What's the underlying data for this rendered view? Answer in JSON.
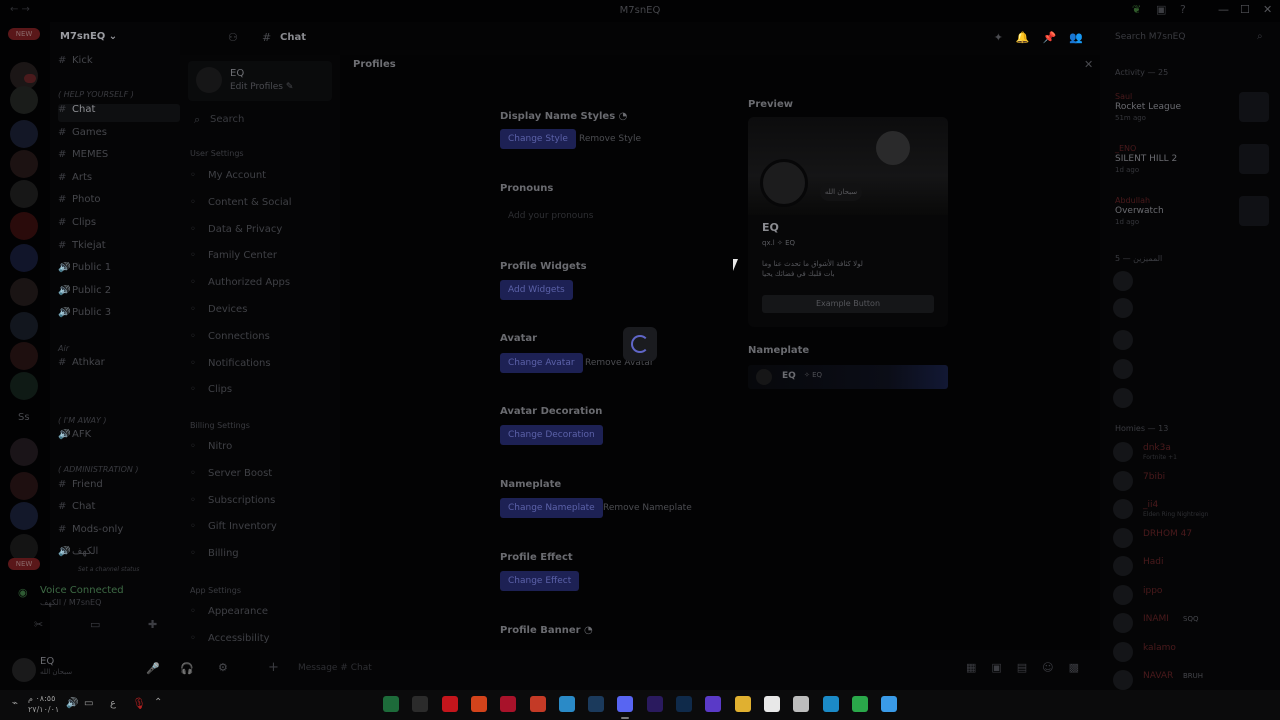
{
  "window": {
    "title": "M7snEQ",
    "back": "←  →"
  },
  "server": {
    "name": "M7snEQ"
  },
  "rail": {
    "new_label": "NEW",
    "ss_label": "Ss"
  },
  "channels": {
    "items": [
      {
        "label": "Kick",
        "icon": "#",
        "active": false
      },
      {
        "label": "Chat",
        "icon": "#",
        "active": true
      },
      {
        "label": "Games",
        "icon": "#",
        "active": false
      },
      {
        "label": "MEMES",
        "icon": "#",
        "active": false
      },
      {
        "label": "Arts",
        "icon": "#",
        "active": false
      },
      {
        "label": "Photo",
        "icon": "#",
        "active": false
      },
      {
        "label": "Clips",
        "icon": "#",
        "active": false
      },
      {
        "label": "Tkiejat",
        "icon": "#",
        "active": false
      },
      {
        "label": "Public 1",
        "icon": "🔊",
        "active": false
      },
      {
        "label": "Public 2",
        "icon": "🔊",
        "active": false
      },
      {
        "label": "Public 3",
        "icon": "🔊",
        "active": false
      },
      {
        "label": "Athkar",
        "icon": "#",
        "active": false
      },
      {
        "label": "AFK",
        "icon": "🔊",
        "active": false
      },
      {
        "label": "Friend",
        "icon": "#",
        "active": false
      },
      {
        "label": "Chat",
        "icon": "#",
        "active": false
      },
      {
        "label": "Mods-only",
        "icon": "#",
        "active": false
      },
      {
        "label": "الكهف",
        "icon": "🔊",
        "active": false
      }
    ],
    "cat_help": "( HELP YOURSELF )",
    "cat_air": "Air",
    "cat_away": "( I'M AWAY )",
    "cat_admin": "( ADMINISTRATION )",
    "channel_status": "Set a channel status"
  },
  "voice": {
    "title": "Voice Connected",
    "sub": "الكهف / M7snEQ"
  },
  "user": {
    "name": "EQ",
    "status": "سبحان الله"
  },
  "settings_nav": {
    "profile_name": "EQ",
    "profile_edit": "Edit Profiles ✎",
    "search_placeholder": "Search",
    "user_settings_head": "User Settings",
    "user_items": [
      "My Account",
      "Content & Social",
      "Data & Privacy",
      "Family Center",
      "Authorized Apps",
      "Devices",
      "Connections",
      "Notifications",
      "Clips"
    ],
    "billing_head": "Billing Settings",
    "billing_items": [
      "Nitro",
      "Server Boost",
      "Subscriptions",
      "Gift Inventory",
      "Billing"
    ],
    "app_head": "App Settings",
    "app_items": [
      "Appearance",
      "Accessibility"
    ]
  },
  "main": {
    "page_title": "Profiles",
    "display_name_styles": "Display Name Styles",
    "change_style": "Change Style",
    "remove_style": "Remove Style",
    "pronouns": "Pronouns",
    "pronouns_placeholder": "Add your pronouns",
    "profile_widgets": "Profile Widgets",
    "add_widgets": "Add Widgets",
    "avatar": "Avatar",
    "change_avatar": "Change Avatar",
    "remove_avatar": "Remove Avatar",
    "avatar_decoration": "Avatar Decoration",
    "change_decoration": "Change Decoration",
    "nameplate": "Nameplate",
    "change_nameplate": "Change Nameplate",
    "remove_nameplate": "Remove Nameplate",
    "profile_effect": "Profile Effect",
    "change_effect": "Change Effect",
    "profile_banner": "Profile Banner"
  },
  "preview": {
    "label": "Preview",
    "bubble": "سبحان الله",
    "name": "EQ",
    "meta": "qx.l  ✧ EQ",
    "bio": "لولا كثافة الأشواق ما تحدث عنا وما بات قلبك في فضائك يحيا",
    "button": "Example Button",
    "nameplate_label": "Nameplate",
    "nameplate_name": "EQ",
    "nameplate_tag": "✧ EQ"
  },
  "topbar": {
    "channel": "Chat",
    "icons": "✦🔔📌👥"
  },
  "members": {
    "search": "Search M7snEQ",
    "activity_head": "Activity — 25",
    "activities": [
      {
        "user": "Saul",
        "game": "Rocket League",
        "time": "51m ago"
      },
      {
        "user": "_ENO",
        "game": "SILENT HILL 2",
        "time": "1d ago"
      },
      {
        "user": "Abdullah",
        "game": "Overwatch",
        "time": "1d ago"
      }
    ],
    "group1_head": "المميزين — 5",
    "group2_head": "Homies — 13",
    "members": [
      {
        "name": "dnk3a",
        "status": "Fortnite +1",
        "tag": ""
      },
      {
        "name": "7bibi",
        "status": "",
        "tag": ""
      },
      {
        "name": "_ii4",
        "status": "Elden Ring Nightreign",
        "tag": ""
      },
      {
        "name": "DRHOM 47",
        "status": "",
        "tag": ""
      },
      {
        "name": "Hadi",
        "status": "",
        "tag": ""
      },
      {
        "name": "ippo",
        "status": "",
        "tag": ""
      },
      {
        "name": "INAMI",
        "status": "",
        "tag": "SQQ"
      },
      {
        "name": "kalamo",
        "status": "",
        "tag": ""
      },
      {
        "name": "NAVAR",
        "status": "",
        "tag": "BRUH"
      }
    ]
  },
  "chat_input": {
    "placeholder": "Message # Chat"
  },
  "taskbar": {
    "clock": "٠٨:٥٥ م\n٢٧/١٠/٠١",
    "lang": "ع"
  }
}
